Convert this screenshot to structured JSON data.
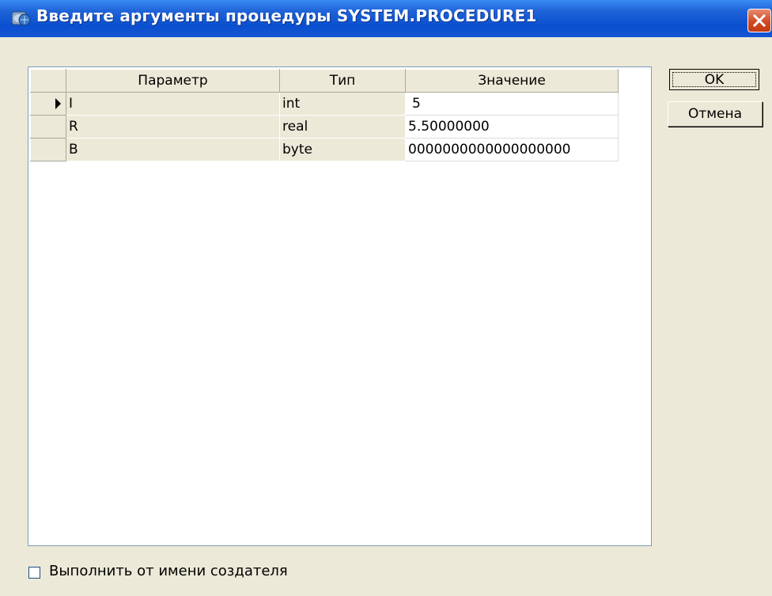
{
  "window": {
    "title": "Введите аргументы процедуры SYSTEM.PROCEDURE1",
    "icon": "database-globe-icon",
    "close_icon": "close-x-icon",
    "close_color": "#d2522c",
    "titlebar_color": "#0a4fcf"
  },
  "grid": {
    "columns": [
      "Параметр",
      "Тип",
      "Значение"
    ],
    "rows": [
      {
        "param": "I",
        "type": "int",
        "value": "5",
        "current": true
      },
      {
        "param": "R",
        "type": "real",
        "value": "5.50000000",
        "current": false
      },
      {
        "param": "B",
        "type": "byte",
        "value": "0000000000000000000",
        "current": false
      }
    ]
  },
  "buttons": {
    "ok": "OK",
    "cancel": "Отмена"
  },
  "checkbox": {
    "label": "Выполнить от имени создателя",
    "checked": false
  }
}
